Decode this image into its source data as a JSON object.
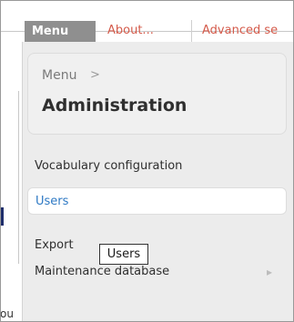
{
  "tabs": {
    "menu_label": "Menu",
    "about_label": "About...",
    "advanced_label": "Advanced se"
  },
  "dropdown": {
    "breadcrumb_parent": "Menu",
    "breadcrumb_arrow": ">",
    "title": "Administration",
    "items": [
      {
        "label": "Vocabulary configuration"
      },
      {
        "label": "Users",
        "selected": true
      },
      {
        "label": "Export"
      },
      {
        "label": "Maintenance database",
        "has_submenu": true
      }
    ],
    "submenu_arrow": "▸"
  },
  "tooltip": {
    "text": "Users"
  },
  "background": {
    "fragment_text": "ou"
  },
  "colors": {
    "tab_active_bg": "#8f8f8f",
    "tab_link": "#d45a4a",
    "selected_item": "#2e79c4",
    "panel_bg": "#ececec"
  }
}
